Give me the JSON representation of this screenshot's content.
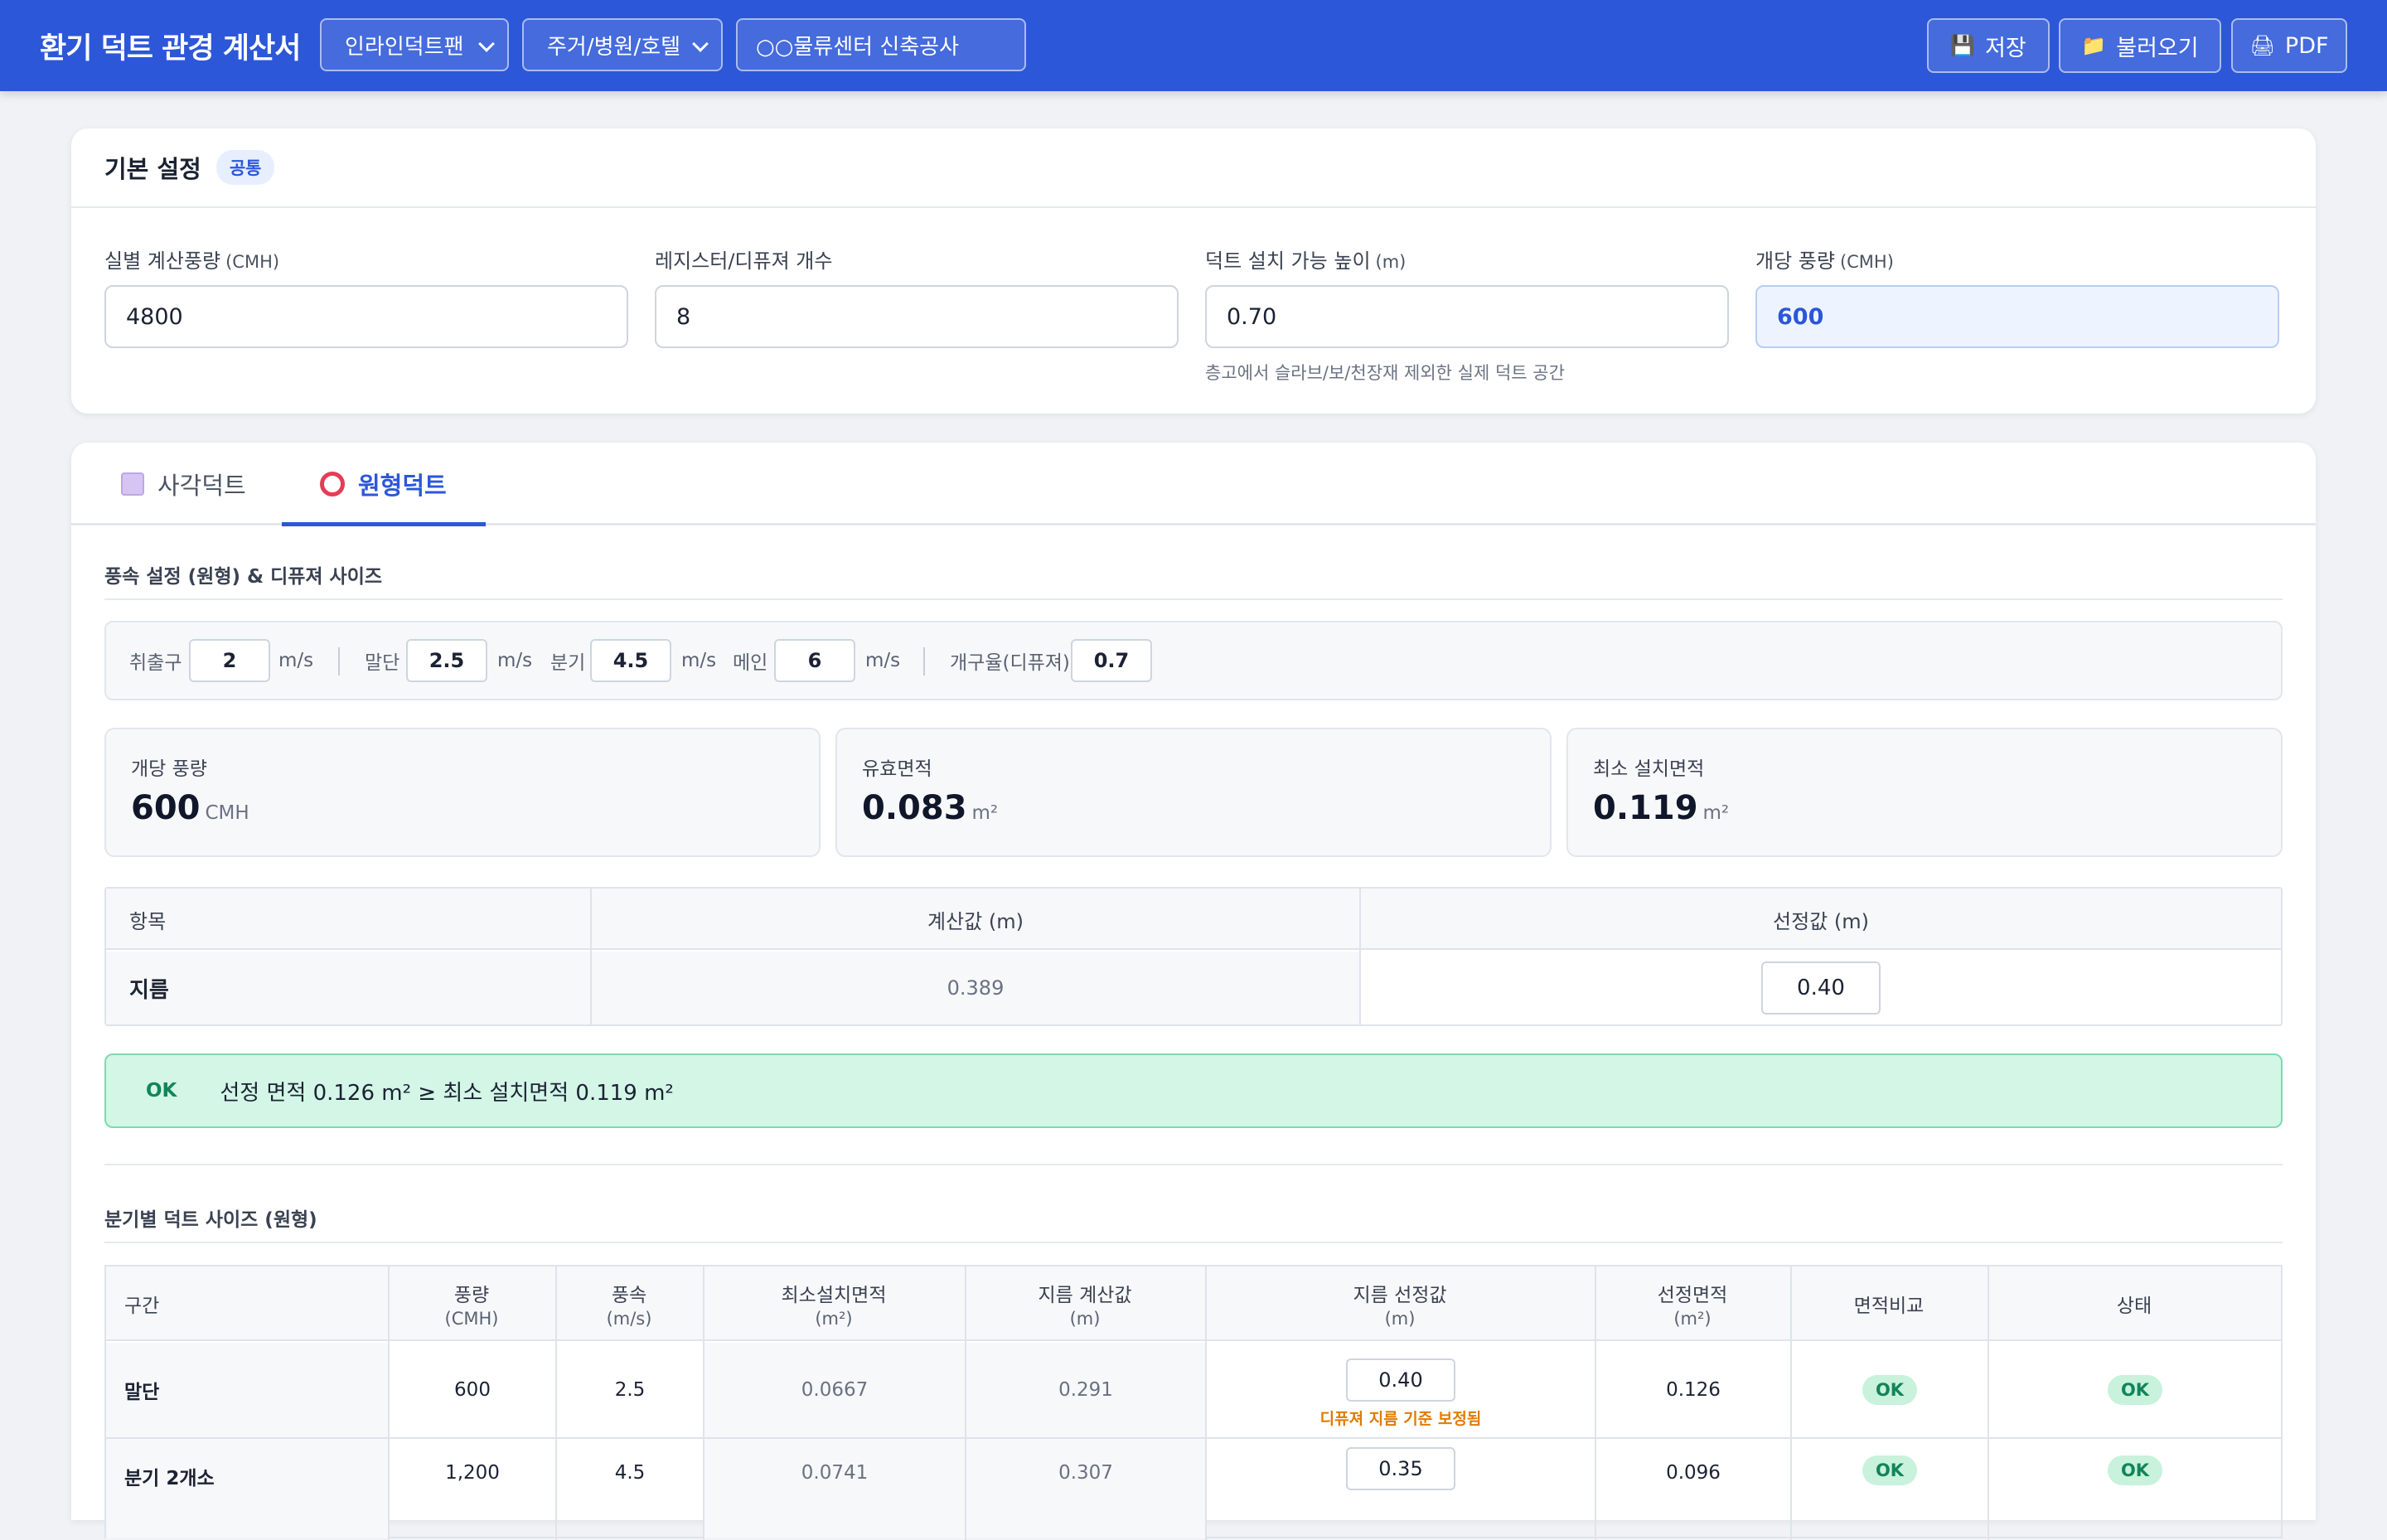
{
  "header": {
    "title": "환기 덕트 관경 계산서",
    "fan_type": "인라인덕트팬",
    "building_type": "주거/병원/호텔",
    "project_name": "○○물류센터 신축공사",
    "buttons": [
      {
        "label": "저장",
        "icon": "floppy-disk-icon"
      },
      {
        "label": "불러오기",
        "icon": "folder-icon"
      },
      {
        "label": "PDF",
        "icon": "document-icon"
      }
    ]
  },
  "basic": {
    "title": "기본 설정",
    "badge": "공통",
    "fields": [
      {
        "label": "실별 계산풍량",
        "unit": "(CMH)",
        "value": "4800"
      },
      {
        "label": "레지스터/디퓨져 개수",
        "unit": "",
        "value": "8"
      },
      {
        "label": "덕트 설치 가능 높이",
        "unit": "(m)",
        "value": "0.70",
        "help": "층고에서 슬라브/보/천장재 제외한 실제 덕트 공간"
      },
      {
        "label": "개당 풍량",
        "unit": "(CMH)",
        "value": "600"
      }
    ]
  },
  "tabs": [
    {
      "label": "사각덕트",
      "active": false
    },
    {
      "label": "원형덕트",
      "active": true
    }
  ],
  "velocity": {
    "section_title": "풍속 설정 (원형) & 디퓨져 사이즈",
    "items": [
      {
        "label": "취출구",
        "value": "2",
        "unit": "m/s"
      },
      {
        "label": "말단",
        "value": "2.5",
        "unit": "m/s"
      },
      {
        "label": "분기",
        "value": "4.5",
        "unit": "m/s"
      },
      {
        "label": "메인",
        "value": "6",
        "unit": "m/s"
      },
      {
        "label": "개구율(디퓨져)",
        "value": "0.7",
        "unit": ""
      }
    ]
  },
  "stats": [
    {
      "label": "개당 풍량",
      "value": "600",
      "unit": "CMH"
    },
    {
      "label": "유효면적",
      "value": "0.083",
      "unit": "m²"
    },
    {
      "label": "최소 설치면적",
      "value": "0.119",
      "unit": "m²"
    }
  ],
  "diameter_table": {
    "headers": [
      "항목",
      "계산값 (m)",
      "선정값 (m)"
    ],
    "row": {
      "item": "지름",
      "calc": "0.389",
      "selected": "0.40"
    }
  },
  "check": {
    "status": "OK",
    "message": "선정 면적 0.126 m² ≥ 최소 설치면적 0.119 m²"
  },
  "branch": {
    "section_title": "분기별 덕트 사이즈 (원형)",
    "headers": [
      {
        "a": "구간",
        "b": ""
      },
      {
        "a": "풍량",
        "b": "(CMH)"
      },
      {
        "a": "풍속",
        "b": "(m/s)"
      },
      {
        "a": "최소설치면적",
        "b": "(m²)"
      },
      {
        "a": "지름 계산값",
        "b": "(m)"
      },
      {
        "a": "지름 선정값",
        "b": "(m)"
      },
      {
        "a": "선정면적",
        "b": "(m²)"
      },
      {
        "a": "면적비교",
        "b": ""
      },
      {
        "a": "상태",
        "b": ""
      }
    ],
    "rows": [
      {
        "section": "말단",
        "flow": "600",
        "vel": "2.5",
        "min_area": "0.0667",
        "dia_calc": "0.291",
        "dia_sel": "0.40",
        "note": "디퓨져 지름 기준 보정됨",
        "sel_area": "0.126",
        "compare": "OK",
        "status": "OK"
      },
      {
        "section": "분기 2개소",
        "flow": "1,200",
        "vel": "4.5",
        "min_area": "0.0741",
        "dia_calc": "0.307",
        "dia_sel": "0.35",
        "note": "",
        "sel_area": "0.096",
        "compare": "OK",
        "status": "OK"
      }
    ]
  },
  "colors": {
    "primary": "#2c57d8",
    "ok_bg": "#d3f6e6",
    "ok_text": "#11855a",
    "note": "#e07b00"
  }
}
